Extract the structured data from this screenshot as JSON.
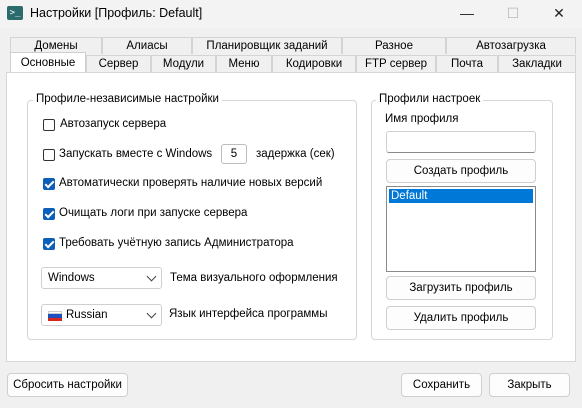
{
  "window": {
    "title": "Настройки [Профиль: Default]",
    "app_icon_glyph": ">_",
    "minimize_glyph": "—",
    "maximize_glyph": "☐",
    "close_glyph": "✕"
  },
  "tabs_row_back": [
    "Домены",
    "Алиасы",
    "Планировщик заданий",
    "Разное",
    "Автозагрузка"
  ],
  "tabs_row_front": [
    "Основные",
    "Сервер",
    "Модули",
    "Меню",
    "Кодировки",
    "FTP сервер",
    "Почта",
    "Закладки"
  ],
  "active_tab": "Основные",
  "general": {
    "group_title": "Профиле-независимые настройки",
    "autostart_label": "Автозапуск сервера",
    "autostart_checked": false,
    "start_with_windows_label": "Запускать вместе с Windows",
    "start_with_windows_checked": false,
    "delay_value": "5",
    "delay_label": "задержка (сек)",
    "check_updates_label": "Автоматически проверять наличие новых версий",
    "check_updates_checked": true,
    "clear_logs_label": "Очищать логи при запуске сервера",
    "clear_logs_checked": true,
    "require_admin_label": "Требовать учётную запись Администратора",
    "require_admin_checked": true,
    "theme_value": "Windows",
    "theme_label": "Тема визуального оформления",
    "language_value": "Russian",
    "language_label": "Язык интерфейса программы",
    "flag_colors": [
      "#ffffff",
      "#1c4fbf",
      "#d7261e"
    ]
  },
  "profiles": {
    "group_title": "Профили настроек",
    "name_label": "Имя профиля",
    "name_value": "",
    "create_button": "Создать профиль",
    "items": [
      "Default"
    ],
    "load_button": "Загрузить профиль",
    "delete_button": "Удалить профиль"
  },
  "footer": {
    "reset_button": "Сбросить настройки",
    "save_button": "Сохранить",
    "close_button": "Закрыть"
  },
  "colors": {
    "accent": "#0c5fb8",
    "selection": "#0078d7"
  }
}
